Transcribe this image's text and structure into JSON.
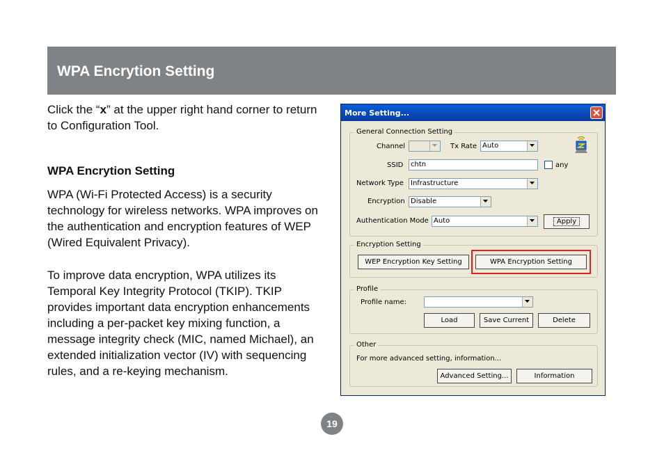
{
  "header": {
    "title": "WPA Encrytion Setting"
  },
  "intro": {
    "before": "Click the “",
    "bold": "x",
    "after": "” at the upper right hand corner to return to Configuration Tool."
  },
  "section": {
    "heading": "WPA Encrytion Setting",
    "paragraph1": "WPA (Wi-Fi Protected Access) is a security technology for wireless networks. WPA improves on the authentication and encryption features of WEP (Wired Equivalent Privacy).",
    "paragraph2": "To improve data encryption, WPA utilizes its Temporal Key Integrity Protocol (TKIP). TKIP provides important data encryption enhancements including a per-packet key mixing function, a message integrity check (MIC, named Michael), an extended initialization vector (IV) with sequencing rules, and a re-keying mechanism."
  },
  "dialog": {
    "title": "More Setting...",
    "general": {
      "label": "General Connection Setting",
      "channel_label": "Channel",
      "channel_value": "",
      "txrate_label": "Tx Rate",
      "txrate_value": "Auto",
      "ssid_label": "SSID",
      "ssid_value": "chtn",
      "any_label": "any",
      "network_type_label": "Network Type",
      "network_type_value": "Infrastructure",
      "encryption_label": "Encryption",
      "encryption_value": "Disable",
      "auth_mode_label": "Authentication Mode",
      "auth_mode_value": "Auto",
      "apply_label": "Apply"
    },
    "encryption": {
      "label": "Encryption Setting",
      "wep_button": "WEP Encryption Key Setting",
      "wpa_button": "WPA Encryption Setting"
    },
    "profile": {
      "label": "Profile",
      "name_label": "Profile name:",
      "name_value": "",
      "load_button": "Load",
      "save_button": "Save Current",
      "delete_button": "Delete"
    },
    "other": {
      "label": "Other",
      "description": "For more advanced setting, information...",
      "advanced_button": "Advanced Setting...",
      "information_button": "Information"
    }
  },
  "page_number": "19"
}
